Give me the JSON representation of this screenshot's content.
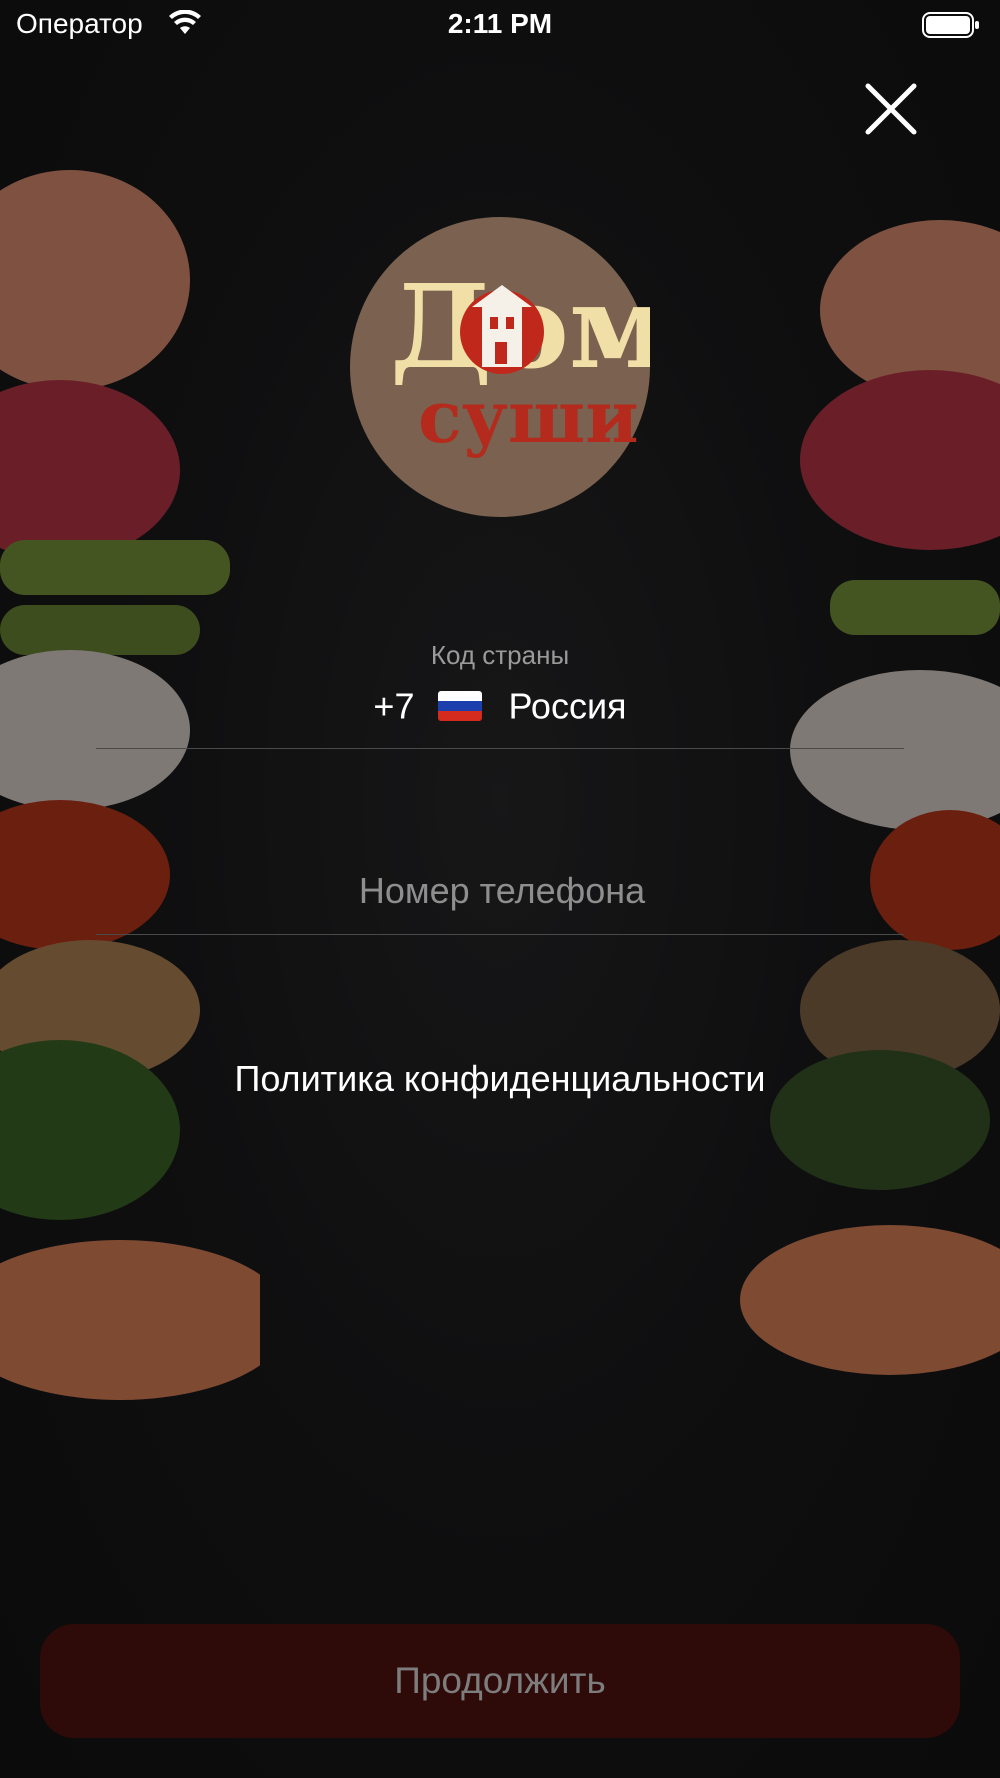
{
  "status_bar": {
    "carrier": "Оператор",
    "time": "2:11 PM",
    "wifi_icon": "wifi-icon",
    "battery_icon": "battery-icon"
  },
  "header": {
    "close_icon": "close-icon"
  },
  "logo": {
    "text_top": "Дом",
    "text_bottom": "суши",
    "background_color": "#7a6150"
  },
  "country": {
    "label": "Код страны",
    "code": "+7",
    "flag_icon": "russia-flag-icon",
    "name": "Россия"
  },
  "phone": {
    "placeholder": "Номер телефона",
    "value": ""
  },
  "privacy": {
    "link_text": "Политика конфиденциальности"
  },
  "actions": {
    "continue_label": "Продолжить",
    "continue_color": "#2e0a08"
  }
}
